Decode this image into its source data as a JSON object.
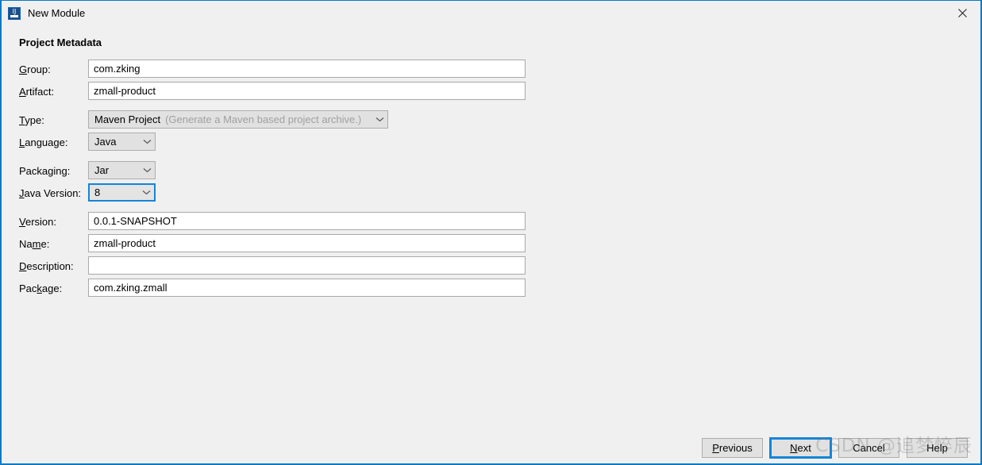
{
  "window": {
    "title": "New Module",
    "app_icon": "intellij-idea-icon",
    "close_icon": "close-icon",
    "border_color": "#0b7ac4",
    "background_color": "#f0f0f0"
  },
  "section": {
    "heading": "Project Metadata"
  },
  "form": {
    "fields": [
      {
        "name": "group",
        "label": "Group:",
        "mnemonic": "G",
        "type": "text",
        "value": "com.zking",
        "placeholder": ""
      },
      {
        "name": "artifact",
        "label": "Artifact:",
        "mnemonic": "A",
        "type": "text",
        "value": "zmall-product",
        "placeholder": ""
      },
      {
        "name": "type",
        "label": "Type:",
        "mnemonic": "T",
        "type": "combo",
        "value": "Maven Project",
        "hint": "(Generate a Maven based project archive.)",
        "focused": false
      },
      {
        "name": "language",
        "label": "Language:",
        "mnemonic": "L",
        "type": "combo",
        "value": "Java",
        "focused": false
      },
      {
        "name": "packaging",
        "label": "Packaging:",
        "mnemonic": "g",
        "type": "combo",
        "value": "Jar",
        "focused": false
      },
      {
        "name": "java-version",
        "label": "Java Version:",
        "mnemonic": "J",
        "type": "combo",
        "value": "8",
        "focused": true
      },
      {
        "name": "version",
        "label": "Version:",
        "mnemonic": "V",
        "type": "text",
        "value": "0.0.1-SNAPSHOT",
        "placeholder": ""
      },
      {
        "name": "module-name",
        "label": "Name:",
        "mnemonic": "m",
        "type": "text",
        "value": "zmall-product",
        "placeholder": ""
      },
      {
        "name": "description",
        "label": "Description:",
        "mnemonic": "D",
        "type": "text",
        "value": "",
        "placeholder": ""
      },
      {
        "name": "package",
        "label": "Package:",
        "mnemonic": "k",
        "type": "text",
        "value": "com.zking.zmall",
        "placeholder": ""
      }
    ]
  },
  "footer": {
    "previous_label": "Previous",
    "next_label": "Next",
    "cancel_label": "Cancel",
    "help_label": "Help",
    "focused_button": "Next",
    "accent_color": "#1585d8"
  },
  "watermark": {
    "text": "CSDN @追梦悴辰"
  }
}
